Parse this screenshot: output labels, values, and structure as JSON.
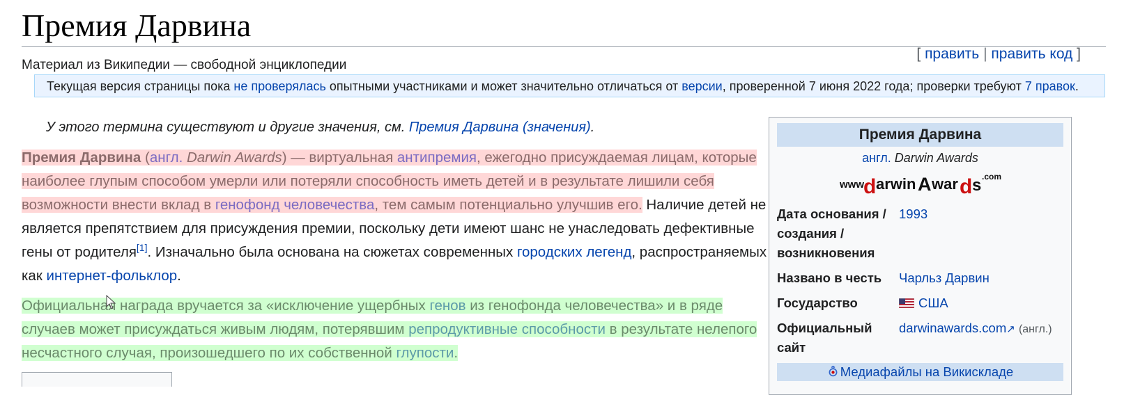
{
  "page": {
    "title": "Премия Дарвина",
    "tagline": "Материал из Википедии — свободной энциклопедии"
  },
  "edit": {
    "open": "[",
    "edit": "править",
    "sep": "|",
    "edit_source": "править код",
    "close": "]"
  },
  "notice": {
    "t1": "Текущая версия страницы пока ",
    "l1": "не проверялась",
    "t2": " опытными участниками и может значительно отличаться от ",
    "l2": "версии",
    "t3": ", проверенной 7 июня 2022 года; проверки требуют ",
    "l3": "7 правок",
    "t4": "."
  },
  "hatnote": {
    "text": "У этого термина существуют и другие значения, см. ",
    "link": "Премия Дарвина (значения)",
    "end": "."
  },
  "para1": {
    "bold": "Премия Дарвина",
    "t1": " (",
    "lang": "англ.",
    "t2": " ",
    "orig": "Darwin Awards",
    "t3": ") — виртуальная ",
    "l_anti": "антипремия",
    "t4": ", ежегодно присуждаемая лицам, которые наиболее глупым способом умерли или потеряли способность иметь детей и в результате лишили себя возможности внести вклад в ",
    "l_gene": "генофонд человечества",
    "t5": ", тем самым потенциально улучшив его.",
    "t6": " Наличие детей не является препятствием для присуждения премии, поскольку дети имеют шанс не унаследовать дефективные гены от родителя",
    "ref": "[1]",
    "t7": ". Изначально была основана на сюжетах современных ",
    "l_legend": "городских легенд",
    "t8": ", распространяемых как ",
    "l_folk": "интернет-фольклор",
    "t9": "."
  },
  "para2": {
    "t1": "Официальная награда вручается за «исключение ущербных ",
    "l_genes": "генов",
    "t2": " из генофонда человечества» и в ряде случаев может присуждаться живым людям, потерявшим ",
    "l_repro": "репродуктивные способности",
    "t3": " в результате нелепого несчастного случая, произошедшего по их собственной ",
    "l_stupid": "глупости",
    "t4": "."
  },
  "infobox": {
    "title": "Премия Дарвина",
    "lang": "англ.",
    "orig": "Darwin Awards",
    "logo_text": "www.darwinAwards.com",
    "rows": [
      {
        "label": "Дата основания / создания / возникновения",
        "value": "1993"
      },
      {
        "label": "Названо в честь",
        "value": "Чарльз Дарвин"
      },
      {
        "label": "Государство",
        "value": "США"
      },
      {
        "label": "Официальный сайт",
        "value": "darwinawards.com",
        "note": "(англ.)"
      }
    ],
    "media": "Медиафайлы на Викискладе"
  },
  "colors": {
    "link": "#0645ad",
    "highlight_red": "#ffc8c8",
    "highlight_green": "#c8ffc8",
    "infobox_header": "#cedff2"
  }
}
